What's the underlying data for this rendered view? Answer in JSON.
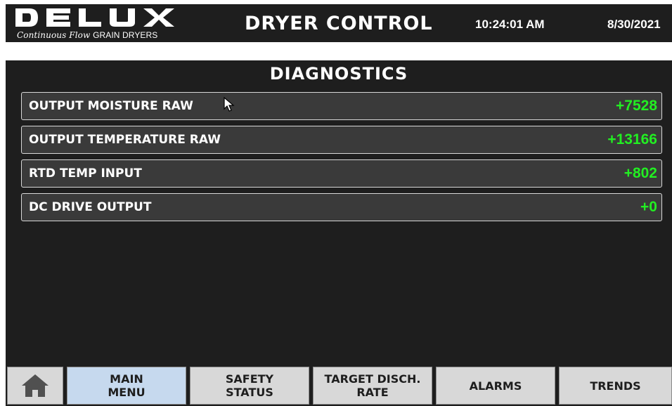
{
  "header": {
    "logo_text": "DELUX",
    "logo_subtitle_script": "Continuous Flow",
    "logo_subtitle_caps": "GRAIN DRYERS",
    "title": "DRYER CONTROL",
    "time": "10:24:01 AM",
    "date": "8/30/2021"
  },
  "panel": {
    "title": "DIAGNOSTICS",
    "rows": [
      {
        "label": "OUTPUT MOISTURE RAW",
        "value": "+7528"
      },
      {
        "label": "OUTPUT TEMPERATURE RAW",
        "value": "+13166"
      },
      {
        "label": "RTD TEMP INPUT",
        "value": "+802"
      },
      {
        "label": "DC DRIVE OUTPUT",
        "value": "+0"
      }
    ]
  },
  "nav": {
    "home_icon": "home-icon",
    "main_menu": "MAIN\nMENU",
    "safety_status": "SAFETY\nSTATUS",
    "target_disch_rate": "TARGET DISCH.\nRATE",
    "alarms": "ALARMS",
    "trends": "TRENDS"
  },
  "colors": {
    "background": "#1e1e1e",
    "row_background": "#3a3a3a",
    "value_green": "#22ee22",
    "button_gray": "#d8d8d8",
    "button_active": "#c6d9ee"
  }
}
